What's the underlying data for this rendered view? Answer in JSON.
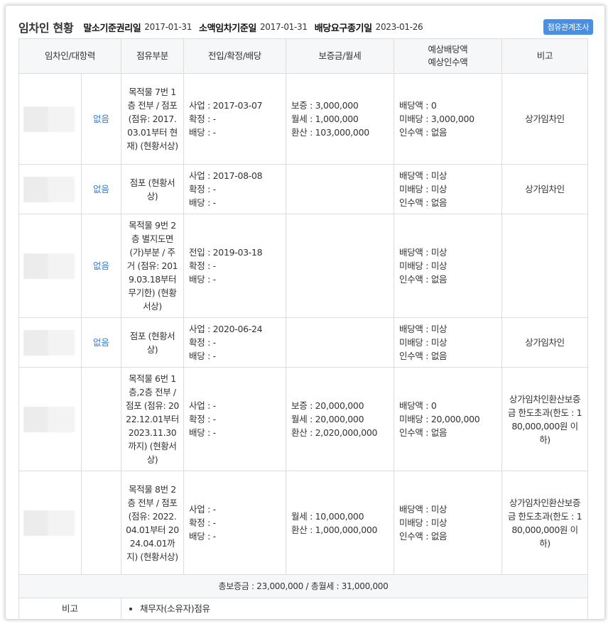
{
  "header": {
    "title": "임차인 현황",
    "malso_label": "말소기준권리일",
    "malso_date": "2017-01-31",
    "soaek_label": "소액임차기준일",
    "soaek_date": "2017-01-31",
    "baedang_label": "배당요구종기일",
    "baedang_date": "2023-01-26",
    "badge": "점유관계조사"
  },
  "columns": {
    "tenant": "임차인/대항력",
    "occupancy": "점유부분",
    "dates": "전입/확정/배당",
    "money": "보증금/월세",
    "expected_line1": "예상배당액",
    "expected_line2": "예상인수액",
    "note": "비고"
  },
  "rows": [
    {
      "opposing": "없음",
      "occupancy": "목적물 7번 1층 전부 / 점포 (점유: 2017.03.01부터 현재) (현황서상)",
      "date1": "사업 : 2017-03-07",
      "date2": "확정 : -",
      "date3": "배당 : -",
      "money1": "보증 : 3,000,000",
      "money2": "월세 : 1,000,000",
      "money3": "환산 : 103,000,000",
      "exp1": "배당액 : 0",
      "exp2": "미배당 : 3,000,000",
      "exp3": "인수액 : 없음",
      "note": "상가임차인"
    },
    {
      "opposing": "없음",
      "occupancy": "점포 (현황서상)",
      "date1": "사업 : 2017-08-08",
      "date2": "확정 : -",
      "date3": "배당 : -",
      "money1": "",
      "money2": "",
      "money3": "",
      "exp1": "배당액 : 미상",
      "exp2": "미배당 : 미상",
      "exp3": "인수액 : 없음",
      "note": "상가임차인"
    },
    {
      "opposing": "없음",
      "occupancy": "목적물 9번 2층 별지도면(가)부분 / 주거 (점유: 2019.03.18부터 무기한) (현황서상)",
      "date1": "전입 : 2019-03-18",
      "date2": "확정 : -",
      "date3": "배당 : -",
      "money1": "",
      "money2": "",
      "money3": "",
      "exp1": "배당액 : 미상",
      "exp2": "미배당 : 미상",
      "exp3": "인수액 : 없음",
      "note": ""
    },
    {
      "opposing": "없음",
      "occupancy": "점포 (현황서상)",
      "date1": "사업 : 2020-06-24",
      "date2": "확정 : -",
      "date3": "배당 : -",
      "money1": "",
      "money2": "",
      "money3": "",
      "exp1": "배당액 : 미상",
      "exp2": "미배당 : 미상",
      "exp3": "인수액 : 없음",
      "note": "상가임차인"
    },
    {
      "opposing": "",
      "occupancy": "목적물 6번 1층,2층 전부 / 점포 (점유: 2022.12.01부터2023.11.30까지) (현황서상)",
      "date1": "사업 : -",
      "date2": "확정 : -",
      "date3": "배당 : -",
      "money1": "보증 : 20,000,000",
      "money2": "월세 : 20,000,000",
      "money3": "환산 : 2,020,000,000",
      "exp1": "배당액 : 0",
      "exp2": "미배당 : 20,000,000",
      "exp3": "인수액 : 없음",
      "note": "상가임차인환산보증금 한도초과(한도 : 180,000,000원 이하)"
    },
    {
      "opposing": "",
      "occupancy": "목적물 8번 2층 전부 / 점포 (점유: 2022.04.01부터 2024.04.01까지) (현황서상)",
      "date1": "사업 : -",
      "date2": "확정 : -",
      "date3": "배당 : -",
      "money1": "월세 : 10,000,000",
      "money2": "환산 : 1,000,000,000",
      "money3": "",
      "exp1": "배당액 : 미상",
      "exp2": "미배당 : 미상",
      "exp3": "인수액 : 없음",
      "note": "상가임차인환산보증금 한도초과(한도 : 180,000,000원 이하)"
    }
  ],
  "totals": "총보증금 : 23,000,000  /  총월세 : 31,000,000",
  "remark": {
    "label": "비고",
    "item": "채무자(소유자)점유"
  }
}
